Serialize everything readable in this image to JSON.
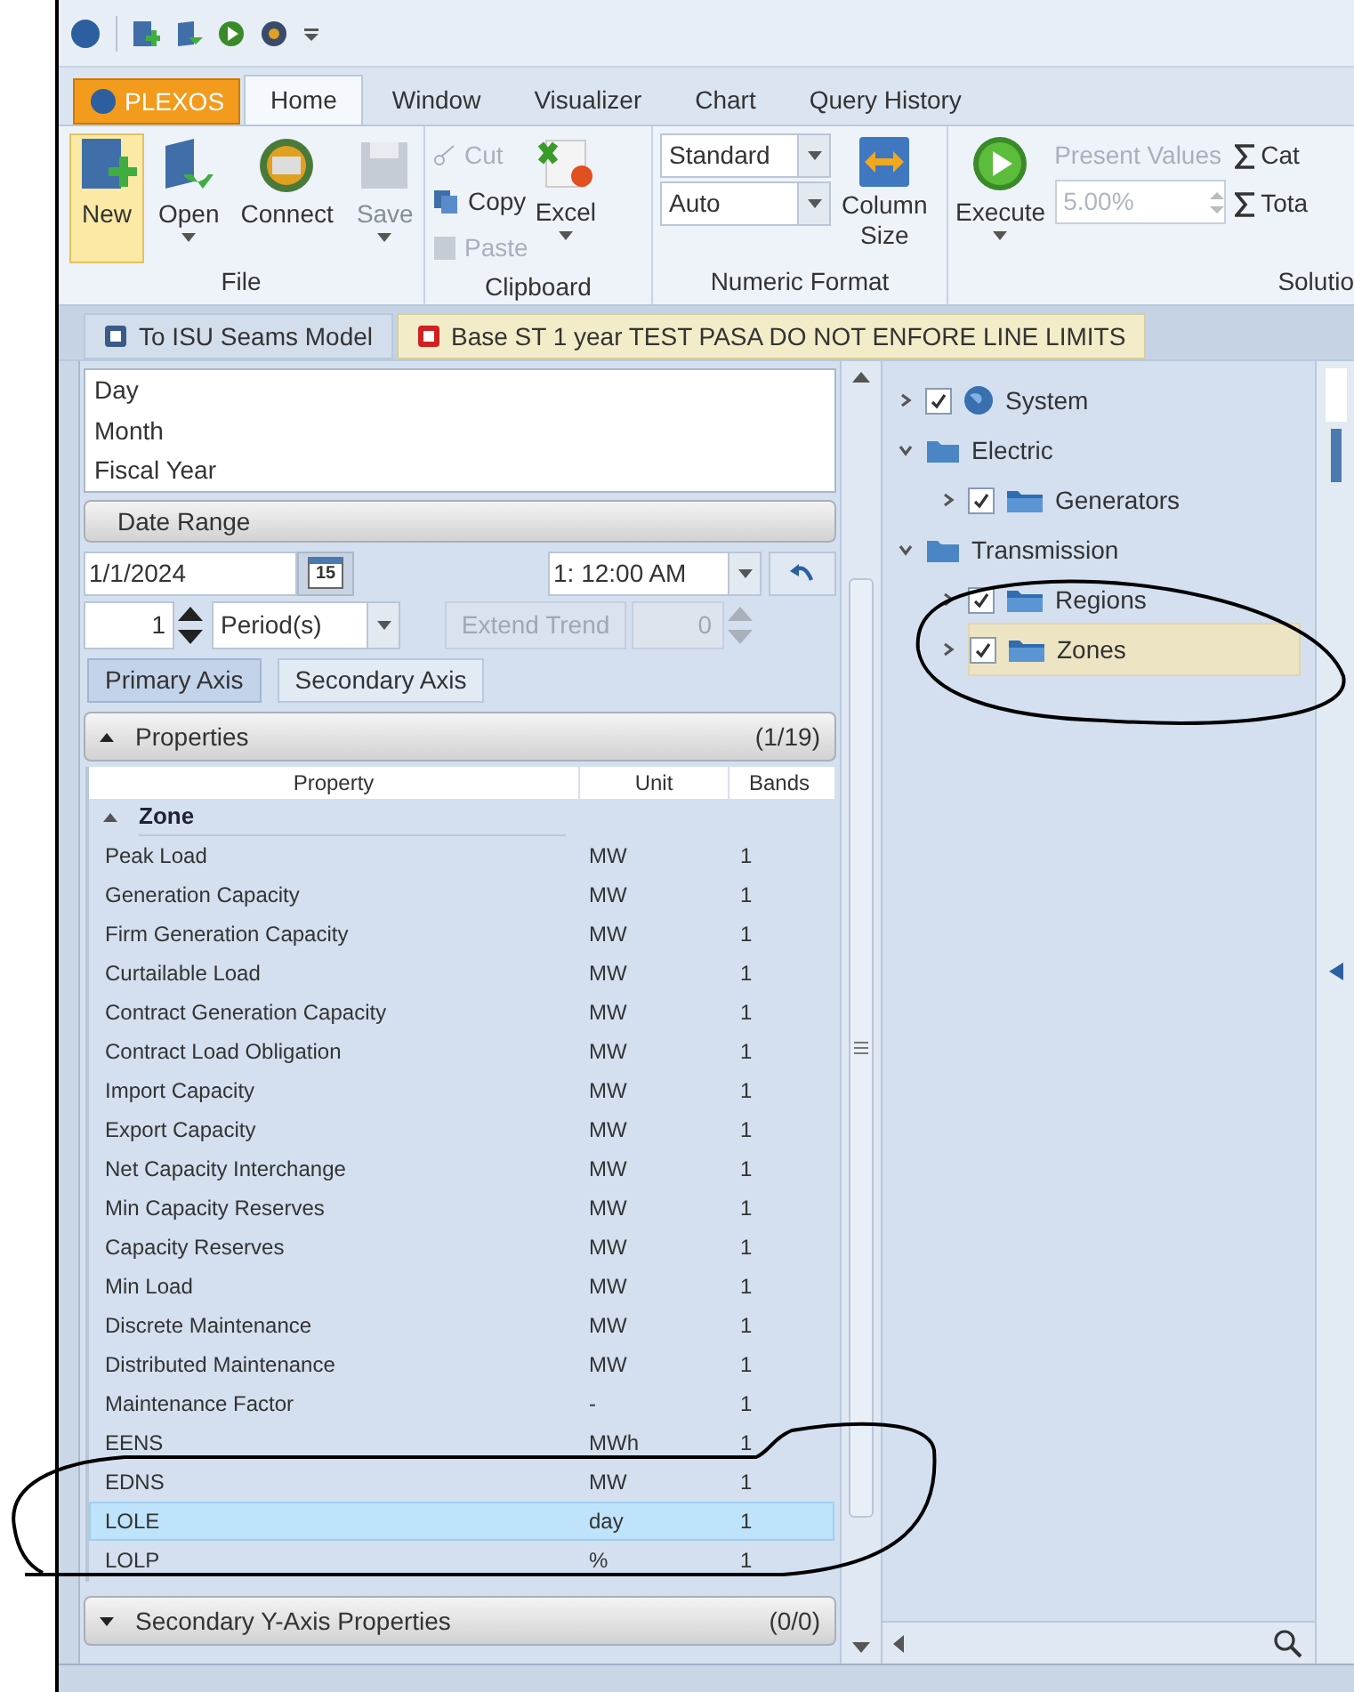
{
  "app_button": "PLEXOS",
  "ribbon_tabs": [
    {
      "label": "Home",
      "selected": true
    },
    {
      "label": "Window",
      "selected": false
    },
    {
      "label": "Visualizer",
      "selected": false
    },
    {
      "label": "Chart",
      "selected": false
    },
    {
      "label": "Query History",
      "selected": false
    }
  ],
  "ribbon": {
    "file": {
      "label": "File",
      "buttons": [
        {
          "label": "New",
          "kind": "new",
          "selected": true,
          "disabled": false,
          "dropdown": false
        },
        {
          "label": "Open",
          "kind": "open",
          "selected": false,
          "disabled": false,
          "dropdown": true
        },
        {
          "label": "Connect",
          "kind": "connect",
          "selected": false,
          "disabled": false,
          "dropdown": false
        },
        {
          "label": "Save",
          "kind": "save",
          "selected": false,
          "disabled": true,
          "dropdown": true
        }
      ]
    },
    "clipboard": {
      "label": "Clipboard",
      "small": [
        {
          "label": "Cut",
          "kind": "cut",
          "disabled": true
        },
        {
          "label": "Copy",
          "kind": "copy",
          "disabled": false
        },
        {
          "label": "Paste",
          "kind": "paste",
          "disabled": true
        }
      ],
      "excel": "Excel"
    },
    "numeric": {
      "label": "Numeric Format",
      "combos": [
        "Standard",
        "Auto"
      ],
      "column_size": [
        "Column",
        "Size"
      ]
    },
    "solution": {
      "label": "Solutio",
      "execute": "Execute",
      "present_values": "Present Values",
      "rate": "5.00%",
      "sums": [
        "Cat",
        "Tota"
      ]
    }
  },
  "doc_tabs": [
    {
      "label": "To ISU Seams Model",
      "selected": false
    },
    {
      "label": "Base ST 1 year TEST PASA DO NOT ENFORE LINE LIMITS",
      "selected": true
    }
  ],
  "left": {
    "periods": [
      "Day",
      "Month",
      "Fiscal Year"
    ],
    "date_range": "Date Range",
    "date": "1/1/2024",
    "calendar_day": "15",
    "time": "1: 12:00 AM",
    "count": "1",
    "unit": "Period(s)",
    "extend_trend": "Extend Trend",
    "extend_value": "0",
    "axes": [
      {
        "label": "Primary Axis",
        "selected": true
      },
      {
        "label": "Secondary Axis",
        "selected": false
      }
    ],
    "properties": {
      "title": "Properties",
      "count": "(1/19)",
      "columns": [
        "Property",
        "Unit",
        "Bands"
      ],
      "group": "Zone",
      "rows": [
        {
          "name": "Peak Load",
          "unit": "MW",
          "bands": "1",
          "selected": false
        },
        {
          "name": "Generation Capacity",
          "unit": "MW",
          "bands": "1",
          "selected": false
        },
        {
          "name": "Firm Generation Capacity",
          "unit": "MW",
          "bands": "1",
          "selected": false
        },
        {
          "name": "Curtailable Load",
          "unit": "MW",
          "bands": "1",
          "selected": false
        },
        {
          "name": "Contract Generation Capacity",
          "unit": "MW",
          "bands": "1",
          "selected": false
        },
        {
          "name": "Contract Load Obligation",
          "unit": "MW",
          "bands": "1",
          "selected": false
        },
        {
          "name": "Import Capacity",
          "unit": "MW",
          "bands": "1",
          "selected": false
        },
        {
          "name": "Export Capacity",
          "unit": "MW",
          "bands": "1",
          "selected": false
        },
        {
          "name": "Net Capacity Interchange",
          "unit": "MW",
          "bands": "1",
          "selected": false
        },
        {
          "name": "Min Capacity Reserves",
          "unit": "MW",
          "bands": "1",
          "selected": false
        },
        {
          "name": "Capacity Reserves",
          "unit": "MW",
          "bands": "1",
          "selected": false
        },
        {
          "name": "Min Load",
          "unit": "MW",
          "bands": "1",
          "selected": false
        },
        {
          "name": "Discrete Maintenance",
          "unit": "MW",
          "bands": "1",
          "selected": false
        },
        {
          "name": "Distributed Maintenance",
          "unit": "MW",
          "bands": "1",
          "selected": false
        },
        {
          "name": "Maintenance Factor",
          "unit": "-",
          "bands": "1",
          "selected": false
        },
        {
          "name": "EENS",
          "unit": "MWh",
          "bands": "1",
          "selected": false
        },
        {
          "name": "EDNS",
          "unit": "MW",
          "bands": "1",
          "selected": false
        },
        {
          "name": "LOLE",
          "unit": "day",
          "bands": "1",
          "selected": true
        },
        {
          "name": "LOLP",
          "unit": "%",
          "bands": "1",
          "selected": false
        }
      ]
    },
    "secondary": {
      "title": "Secondary Y-Axis Properties",
      "count": "(0/0)"
    }
  },
  "tree": [
    {
      "label": "System",
      "kind": "globe",
      "checked": true,
      "expanded": false,
      "selected": false
    },
    {
      "label": "Electric",
      "kind": "folder",
      "expanded": true,
      "selected": false,
      "children": [
        {
          "label": "Generators",
          "kind": "class",
          "checked": true,
          "expanded": false,
          "selected": false
        }
      ]
    },
    {
      "label": "Transmission",
      "kind": "folder",
      "expanded": true,
      "selected": false,
      "children": [
        {
          "label": "Regions",
          "kind": "class",
          "checked": true,
          "expanded": false,
          "selected": false
        },
        {
          "label": "Zones",
          "kind": "class",
          "checked": true,
          "expanded": false,
          "selected": true
        }
      ]
    }
  ]
}
